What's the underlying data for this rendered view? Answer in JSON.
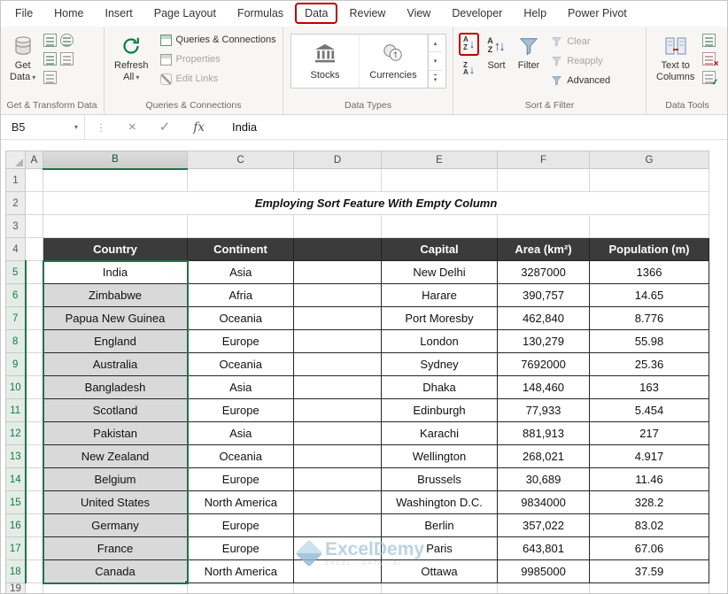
{
  "tabs": [
    "File",
    "Home",
    "Insert",
    "Page Layout",
    "Formulas",
    "Data",
    "Review",
    "View",
    "Developer",
    "Help",
    "Power Pivot"
  ],
  "active_tab": "Data",
  "icons": {
    "caret": "▾",
    "cancel": "×",
    "check": "✓",
    "dots": "⋮",
    "up": "▴",
    "down": "▾",
    "arrow_down": "↓",
    "arrow_up": "↑",
    "letter_a": "A",
    "letter_z": "Z"
  },
  "ribbon": {
    "get_1": "Get",
    "get_2": "Data",
    "refresh_1": "Refresh",
    "refresh_2": "All",
    "queries_connections": "Queries & Connections",
    "properties": "Properties",
    "edit_links": "Edit Links",
    "stocks": "Stocks",
    "currencies": "Currencies",
    "sort": "Sort",
    "filter": "Filter",
    "clear": "Clear",
    "reapply": "Reapply",
    "advanced": "Advanced",
    "ttc_1": "Text to",
    "ttc_2": "Columns",
    "groups": [
      "Get & Transform Data",
      "Queries & Connections",
      "Data Types",
      "Sort & Filter",
      "Data Tools"
    ]
  },
  "formula_bar": {
    "name_box": "B5",
    "fx": "fx",
    "content": "India"
  },
  "sheet": {
    "columns": [
      "A",
      "B",
      "C",
      "D",
      "E",
      "F",
      "G"
    ],
    "row_count": 18,
    "title": "Employing Sort Feature With Empty Column",
    "active_cell": "B5",
    "table": {
      "headers": [
        "Country",
        "Continent",
        "",
        "Capital",
        "Area (km²)",
        "Population (m)"
      ],
      "rows": [
        [
          "India",
          "Asia",
          "",
          "New Delhi",
          "3287000",
          "1366"
        ],
        [
          "Zimbabwe",
          "Afria",
          "",
          "Harare",
          "390,757",
          "14.65"
        ],
        [
          "Papua New Guinea",
          "Oceania",
          "",
          "Port Moresby",
          "462,840",
          "8.776"
        ],
        [
          "England",
          "Europe",
          "",
          "London",
          "130,279",
          "55.98"
        ],
        [
          "Australia",
          "Oceania",
          "",
          "Sydney",
          "7692000",
          "25.36"
        ],
        [
          "Bangladesh",
          "Asia",
          "",
          "Dhaka",
          "148,460",
          "163"
        ],
        [
          "Scotland",
          "Europe",
          "",
          "Edinburgh",
          "77,933",
          "5.454"
        ],
        [
          "Pakistan",
          "Asia",
          "",
          "Karachi",
          "881,913",
          "217"
        ],
        [
          "New Zealand",
          "Oceania",
          "",
          "Wellington",
          "268,021",
          "4.917"
        ],
        [
          "Belgium",
          "Europe",
          "",
          "Brussels",
          "30,689",
          "11.46"
        ],
        [
          "United States",
          "North America",
          "",
          "Washington D.C.",
          "9834000",
          "328.2"
        ],
        [
          "Germany",
          "Europe",
          "",
          "Berlin",
          "357,022",
          "83.02"
        ],
        [
          "France",
          "Europe",
          "",
          "Paris",
          "643,801",
          "67.06"
        ],
        [
          "Canada",
          "North America",
          "",
          "Ottawa",
          "9985000",
          "37.59"
        ]
      ]
    }
  },
  "watermark": {
    "name": "ExcelDemy",
    "tagline": "EXCEL · DATA · BI"
  },
  "colors": {
    "accent_green": "#217346",
    "annotation_red": "#C00000",
    "table_header_bg": "#3B3B3B",
    "title_bg": "#F8CBAD",
    "country_fill": "#D9D9D9"
  }
}
